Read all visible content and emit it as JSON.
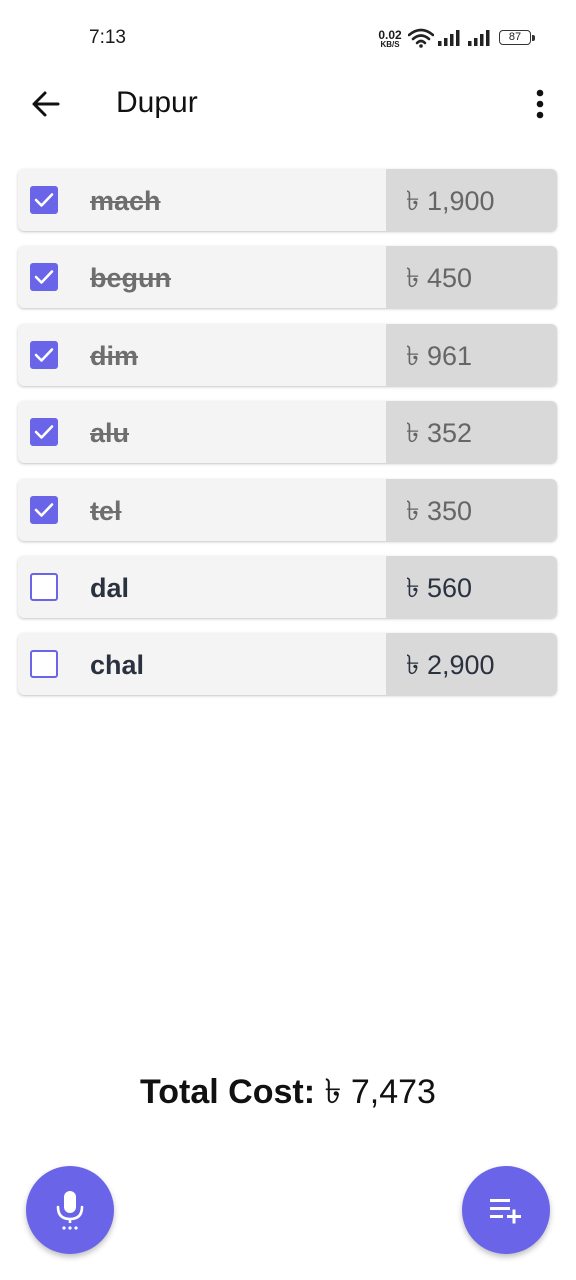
{
  "status_bar": {
    "time": "7:13",
    "net_speed_value": "0.02",
    "net_speed_unit": "KB/S",
    "battery": "87"
  },
  "app_bar": {
    "title": "Dupur",
    "back_icon": "arrow-left-icon",
    "menu_icon": "more-vert-icon"
  },
  "items": [
    {
      "name": "mach",
      "price": "৳ 1,900",
      "checked": true
    },
    {
      "name": "begun",
      "price": "৳ 450",
      "checked": true
    },
    {
      "name": "dim",
      "price": "৳ 961",
      "checked": true
    },
    {
      "name": "alu",
      "price": "৳ 352",
      "checked": true
    },
    {
      "name": "tel",
      "price": "৳ 350",
      "checked": true
    },
    {
      "name": "dal",
      "price": "৳ 560",
      "checked": false
    },
    {
      "name": "chal",
      "price": "৳ 2,900",
      "checked": false
    }
  ],
  "total": {
    "label": "Total Cost:",
    "value": "৳ 7,473"
  },
  "fabs": {
    "mic_icon": "microphone-icon",
    "add_icon": "playlist-add-icon"
  },
  "colors": {
    "accent": "#6a65e8",
    "row_bg": "#f4f4f4",
    "price_bg": "#d9d9d9"
  }
}
